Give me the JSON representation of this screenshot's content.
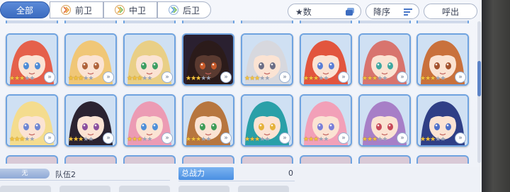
{
  "filters": {
    "tabs": [
      {
        "label": "全部",
        "active": true
      },
      {
        "label": "前卫",
        "icon": "front-position-icon"
      },
      {
        "label": "中卫",
        "icon": "middle-position-icon"
      },
      {
        "label": "后卫",
        "icon": "back-position-icon"
      }
    ],
    "sort_field": "★数",
    "sort_order": "降序",
    "call_button": "呼出"
  },
  "characters": [
    {
      "hair": "#e5604b",
      "eyes": "#4d8bd6",
      "stars": 3
    },
    {
      "hair": "#f0c777",
      "eyes": "#b0643b",
      "stars": 3
    },
    {
      "hair": "#e9cf86",
      "eyes": "#3e9e62",
      "stars": 3
    },
    {
      "hair": "#2b1b1a",
      "eyes": "#c85b2a",
      "stars": 3,
      "dark": true
    },
    {
      "hair": "#d7d8de",
      "eyes": "#6b6e86",
      "stars": 3
    },
    {
      "hair": "#e2553e",
      "eyes": "#5a7ed6",
      "stars": 3
    },
    {
      "hair": "#d8746e",
      "eyes": "#3ea7a0",
      "stars": 3
    },
    {
      "hair": "#c9713c",
      "eyes": "#a3522e",
      "stars": 3
    },
    {
      "hair": "#f4dc8e",
      "eyes": "#6e86d2",
      "stars": 3
    },
    {
      "hair": "#2b2331",
      "eyes": "#8a4f9e",
      "stars": 3
    },
    {
      "hair": "#ec9bb4",
      "eyes": "#4f8fd8",
      "stars": 3
    },
    {
      "hair": "#b7763f",
      "eyes": "#3f9c58",
      "stars": 3
    },
    {
      "hair": "#2aa0a8",
      "eyes": "#e5b23a",
      "stars": 3
    },
    {
      "hair": "#f2a0b8",
      "eyes": "#7a7fd8",
      "stars": 3
    },
    {
      "hair": "#a77fc7",
      "eyes": "#c84a5a",
      "stars": 3
    },
    {
      "hair": "#2f3f86",
      "eyes": "#4d6fc8",
      "stars": 3
    }
  ],
  "party": {
    "team_tag": "无",
    "team_name": "队伍2",
    "power_label": "总战力",
    "power_value": "0"
  }
}
